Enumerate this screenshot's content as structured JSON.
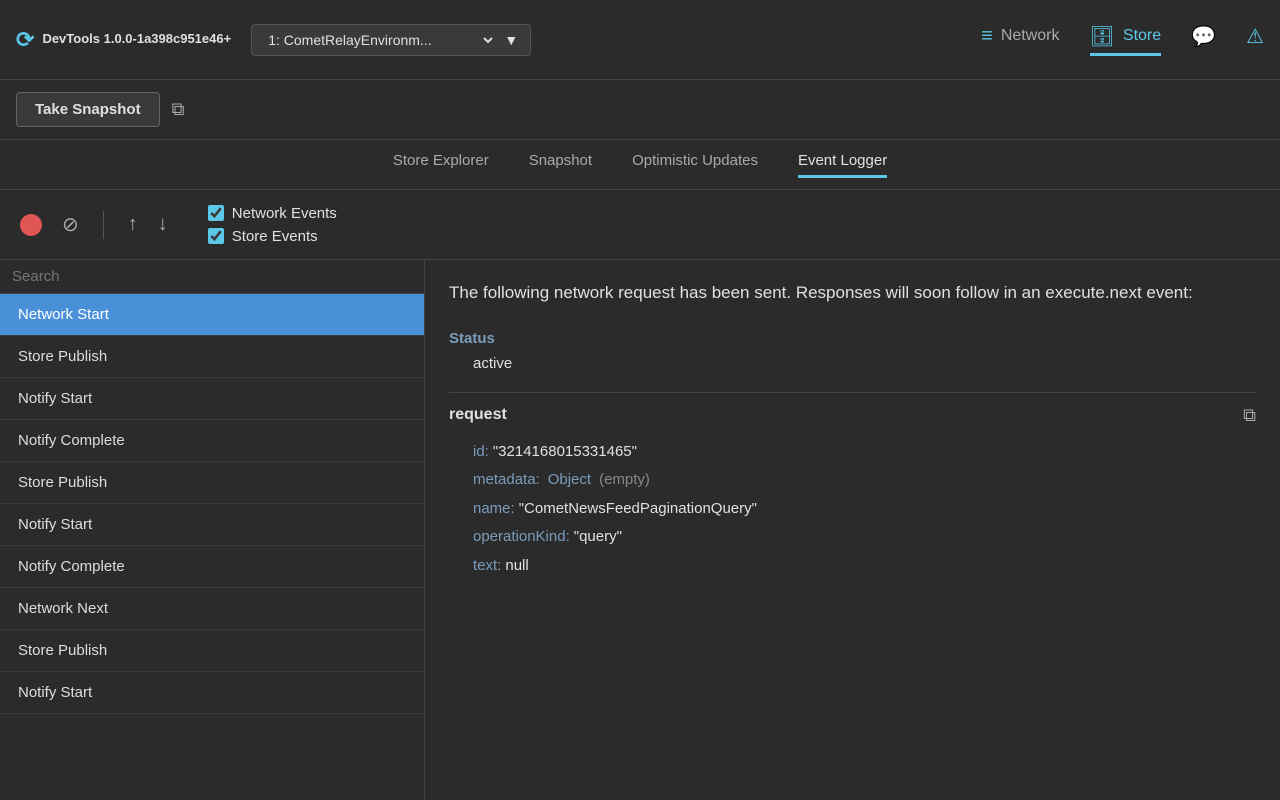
{
  "app": {
    "title": "DevTools 1.0.0-1a398c951e46+"
  },
  "env_selector": {
    "value": "1: CometRelayEnvironm...",
    "options": [
      "1: CometRelayEnvironm..."
    ]
  },
  "nav": {
    "tabs": [
      {
        "id": "network",
        "label": "Network",
        "icon": "≡",
        "active": false
      },
      {
        "id": "store",
        "label": "Store",
        "icon": "🗄",
        "active": true
      },
      {
        "id": "chat",
        "label": "",
        "icon": "💬",
        "active": false
      },
      {
        "id": "alert",
        "label": "",
        "icon": "⚠",
        "active": false
      }
    ]
  },
  "toolbar": {
    "take_snapshot_label": "Take Snapshot",
    "copy_icon_label": "copy"
  },
  "sub_nav": {
    "items": [
      {
        "id": "store-explorer",
        "label": "Store Explorer",
        "active": false
      },
      {
        "id": "snapshot",
        "label": "Snapshot",
        "active": false
      },
      {
        "id": "optimistic-updates",
        "label": "Optimistic Updates",
        "active": false
      },
      {
        "id": "event-logger",
        "label": "Event Logger",
        "active": true
      }
    ]
  },
  "filter": {
    "record_label": "record",
    "clear_label": "clear",
    "upload_label": "upload",
    "download_label": "download",
    "checkboxes": [
      {
        "id": "network-events",
        "label": "Network Events",
        "checked": true
      },
      {
        "id": "store-events",
        "label": "Store Events",
        "checked": true
      }
    ]
  },
  "search": {
    "placeholder": "Search"
  },
  "events": [
    {
      "id": 1,
      "label": "Network Start",
      "selected": true
    },
    {
      "id": 2,
      "label": "Store Publish",
      "selected": false
    },
    {
      "id": 3,
      "label": "Notify Start",
      "selected": false
    },
    {
      "id": 4,
      "label": "Notify Complete",
      "selected": false
    },
    {
      "id": 5,
      "label": "Store Publish",
      "selected": false
    },
    {
      "id": 6,
      "label": "Notify Start",
      "selected": false
    },
    {
      "id": 7,
      "label": "Notify Complete",
      "selected": false
    },
    {
      "id": 8,
      "label": "Network Next",
      "selected": false
    },
    {
      "id": 9,
      "label": "Store Publish",
      "selected": false
    },
    {
      "id": 10,
      "label": "Notify Start",
      "selected": false
    }
  ],
  "detail": {
    "description": "The following network request has been sent. Responses will soon follow in an execute.next event:",
    "status_label": "Status",
    "status_value": "active",
    "request_label": "request",
    "request_fields": {
      "id_key": "id:",
      "id_value": "\"3214168015331465\"",
      "metadata_key": "metadata:",
      "metadata_type": "Object",
      "metadata_empty": "(empty)",
      "name_key": "name:",
      "name_value": "\"CometNewsFeedPaginationQuery\"",
      "operationKind_key": "operationKind:",
      "operationKind_value": "\"query\"",
      "text_key": "text:",
      "text_value": "null"
    }
  }
}
